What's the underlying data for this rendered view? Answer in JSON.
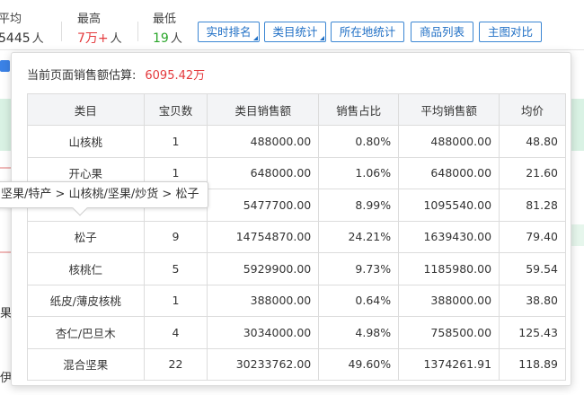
{
  "stats": {
    "avg": {
      "label": "平均",
      "value": "5445",
      "unit": "人"
    },
    "max": {
      "label": "最高",
      "value": "7万+",
      "unit": "人"
    },
    "min": {
      "label": "最低",
      "value": "19",
      "unit": "人"
    }
  },
  "toolbar": {
    "realtime_rank": "实时排名",
    "category_stats": "类目统计",
    "location_stats": "所在地统计",
    "product_list": "商品列表",
    "compare": "主图对比"
  },
  "background": {
    "text_1": "果",
    "text_2": "伊"
  },
  "popup": {
    "summary_label": "当前页面销售额估算:",
    "summary_amount": "6095.42万",
    "table": {
      "headers": [
        "类目",
        "宝贝数",
        "类目销售额",
        "销售占比",
        "平均销售额",
        "均价"
      ],
      "rows": [
        [
          "山核桃",
          "1",
          "488000.00",
          "0.80%",
          "488000.00",
          "48.80"
        ],
        [
          "开心果",
          "1",
          "648000.00",
          "1.06%",
          "648000.00",
          "21.60"
        ],
        [
          "",
          "",
          "5477700.00",
          "8.99%",
          "1095540.00",
          "81.28"
        ],
        [
          "松子",
          "9",
          "14754870.00",
          "24.21%",
          "1639430.00",
          "79.40"
        ],
        [
          "核桃仁",
          "5",
          "5929900.00",
          "9.73%",
          "1185980.00",
          "59.54"
        ],
        [
          "纸皮/薄皮核桃",
          "1",
          "388000.00",
          "0.64%",
          "388000.00",
          "38.80"
        ],
        [
          "杏仁/巴旦木",
          "4",
          "3034000.00",
          "4.98%",
          "758500.00",
          "125.43"
        ],
        [
          "混合坚果",
          "22",
          "30233762.00",
          "49.60%",
          "1374261.91",
          "118.89"
        ]
      ]
    }
  },
  "tooltip": {
    "text": "坚果/特产 > 山核桃/坚果/炒货 > 松子"
  }
}
